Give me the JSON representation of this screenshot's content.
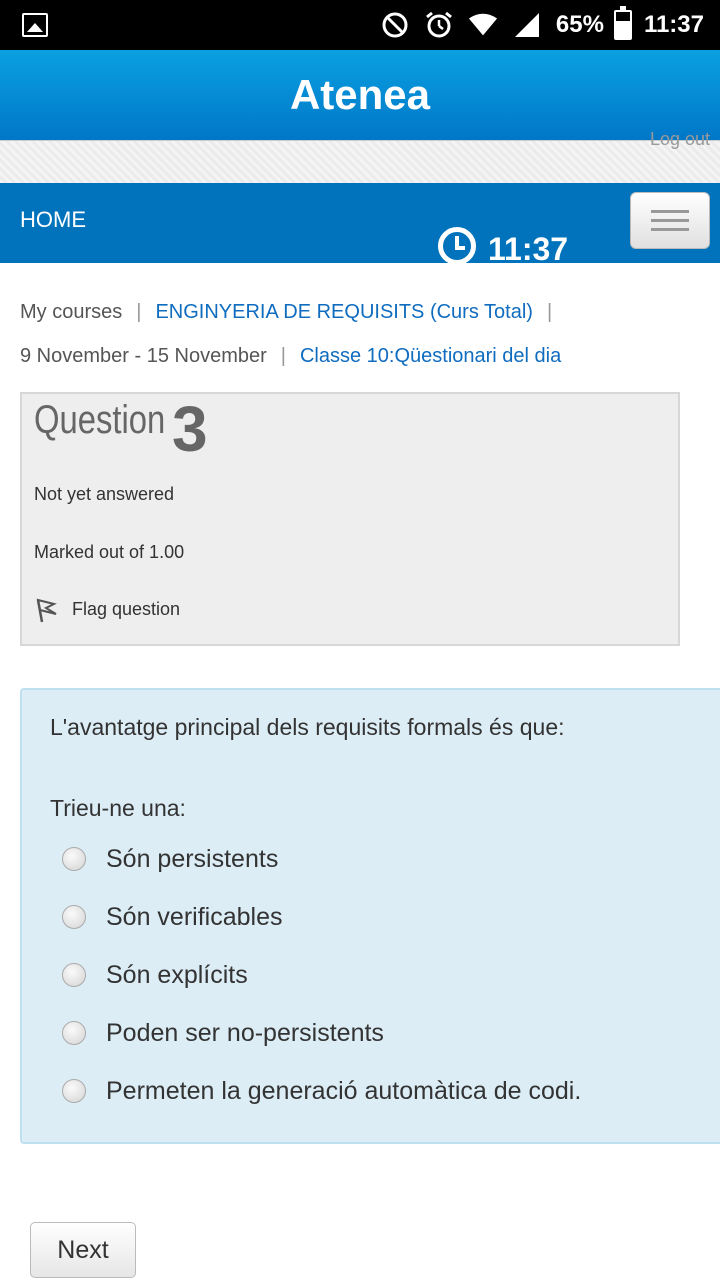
{
  "status_bar": {
    "battery": "65%",
    "time": "11:37"
  },
  "app": {
    "title": "Atenea"
  },
  "strip": {
    "logout_label": "Log out"
  },
  "nav": {
    "home_label": "HOME",
    "timer": "11:37"
  },
  "breadcrumb": {
    "items": [
      "My courses",
      "ENGINYERIA DE REQUISITS (Curs Total)",
      "9 November - 15 November",
      "Classe 10:Qüestionari del dia"
    ]
  },
  "question_info": {
    "label": "Question",
    "number": "3",
    "state": "Not yet answered",
    "grade": "Marked out of 1.00",
    "flag_label": "Flag question"
  },
  "question": {
    "text": "L'avantatge principal dels requisits formals és que:",
    "prompt": "Trieu-ne una:",
    "answers": [
      "Són persistents",
      "Són verificables",
      "Són explícits",
      "Poden ser no-persistents",
      "Permeten la generació automàtica de codi."
    ]
  },
  "buttons": {
    "next": "Next"
  },
  "colors": {
    "header": "#0aa0e0",
    "navbar": "#0073bc",
    "link": "#0f6cbf",
    "question_bg": "#dcedf6"
  }
}
